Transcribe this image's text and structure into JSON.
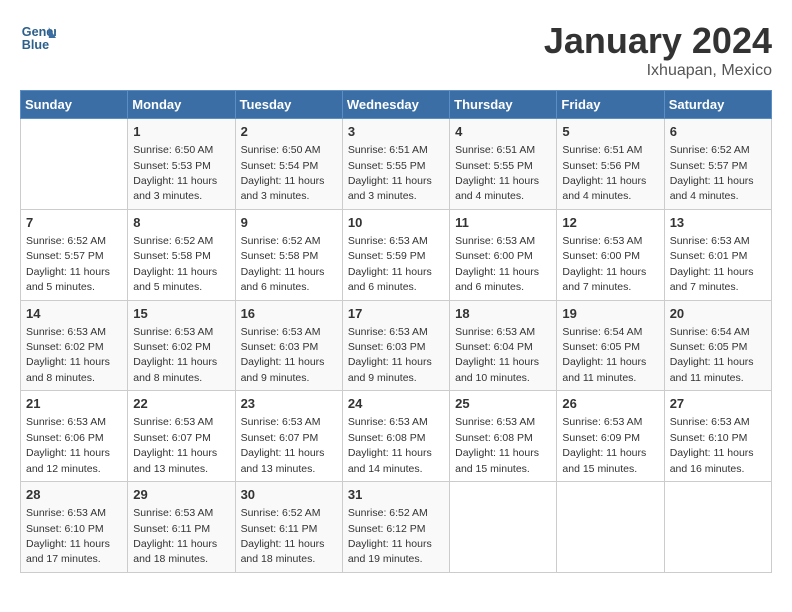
{
  "header": {
    "logo_line1": "General",
    "logo_line2": "Blue",
    "month": "January 2024",
    "location": "Ixhuapan, Mexico"
  },
  "weekdays": [
    "Sunday",
    "Monday",
    "Tuesday",
    "Wednesday",
    "Thursday",
    "Friday",
    "Saturday"
  ],
  "weeks": [
    [
      {
        "day": "",
        "info": ""
      },
      {
        "day": "1",
        "info": "Sunrise: 6:50 AM\nSunset: 5:53 PM\nDaylight: 11 hours\nand 3 minutes."
      },
      {
        "day": "2",
        "info": "Sunrise: 6:50 AM\nSunset: 5:54 PM\nDaylight: 11 hours\nand 3 minutes."
      },
      {
        "day": "3",
        "info": "Sunrise: 6:51 AM\nSunset: 5:55 PM\nDaylight: 11 hours\nand 3 minutes."
      },
      {
        "day": "4",
        "info": "Sunrise: 6:51 AM\nSunset: 5:55 PM\nDaylight: 11 hours\nand 4 minutes."
      },
      {
        "day": "5",
        "info": "Sunrise: 6:51 AM\nSunset: 5:56 PM\nDaylight: 11 hours\nand 4 minutes."
      },
      {
        "day": "6",
        "info": "Sunrise: 6:52 AM\nSunset: 5:57 PM\nDaylight: 11 hours\nand 4 minutes."
      }
    ],
    [
      {
        "day": "7",
        "info": "Sunrise: 6:52 AM\nSunset: 5:57 PM\nDaylight: 11 hours\nand 5 minutes."
      },
      {
        "day": "8",
        "info": "Sunrise: 6:52 AM\nSunset: 5:58 PM\nDaylight: 11 hours\nand 5 minutes."
      },
      {
        "day": "9",
        "info": "Sunrise: 6:52 AM\nSunset: 5:58 PM\nDaylight: 11 hours\nand 6 minutes."
      },
      {
        "day": "10",
        "info": "Sunrise: 6:53 AM\nSunset: 5:59 PM\nDaylight: 11 hours\nand 6 minutes."
      },
      {
        "day": "11",
        "info": "Sunrise: 6:53 AM\nSunset: 6:00 PM\nDaylight: 11 hours\nand 6 minutes."
      },
      {
        "day": "12",
        "info": "Sunrise: 6:53 AM\nSunset: 6:00 PM\nDaylight: 11 hours\nand 7 minutes."
      },
      {
        "day": "13",
        "info": "Sunrise: 6:53 AM\nSunset: 6:01 PM\nDaylight: 11 hours\nand 7 minutes."
      }
    ],
    [
      {
        "day": "14",
        "info": "Sunrise: 6:53 AM\nSunset: 6:02 PM\nDaylight: 11 hours\nand 8 minutes."
      },
      {
        "day": "15",
        "info": "Sunrise: 6:53 AM\nSunset: 6:02 PM\nDaylight: 11 hours\nand 8 minutes."
      },
      {
        "day": "16",
        "info": "Sunrise: 6:53 AM\nSunset: 6:03 PM\nDaylight: 11 hours\nand 9 minutes."
      },
      {
        "day": "17",
        "info": "Sunrise: 6:53 AM\nSunset: 6:03 PM\nDaylight: 11 hours\nand 9 minutes."
      },
      {
        "day": "18",
        "info": "Sunrise: 6:53 AM\nSunset: 6:04 PM\nDaylight: 11 hours\nand 10 minutes."
      },
      {
        "day": "19",
        "info": "Sunrise: 6:54 AM\nSunset: 6:05 PM\nDaylight: 11 hours\nand 11 minutes."
      },
      {
        "day": "20",
        "info": "Sunrise: 6:54 AM\nSunset: 6:05 PM\nDaylight: 11 hours\nand 11 minutes."
      }
    ],
    [
      {
        "day": "21",
        "info": "Sunrise: 6:53 AM\nSunset: 6:06 PM\nDaylight: 11 hours\nand 12 minutes."
      },
      {
        "day": "22",
        "info": "Sunrise: 6:53 AM\nSunset: 6:07 PM\nDaylight: 11 hours\nand 13 minutes."
      },
      {
        "day": "23",
        "info": "Sunrise: 6:53 AM\nSunset: 6:07 PM\nDaylight: 11 hours\nand 13 minutes."
      },
      {
        "day": "24",
        "info": "Sunrise: 6:53 AM\nSunset: 6:08 PM\nDaylight: 11 hours\nand 14 minutes."
      },
      {
        "day": "25",
        "info": "Sunrise: 6:53 AM\nSunset: 6:08 PM\nDaylight: 11 hours\nand 15 minutes."
      },
      {
        "day": "26",
        "info": "Sunrise: 6:53 AM\nSunset: 6:09 PM\nDaylight: 11 hours\nand 15 minutes."
      },
      {
        "day": "27",
        "info": "Sunrise: 6:53 AM\nSunset: 6:10 PM\nDaylight: 11 hours\nand 16 minutes."
      }
    ],
    [
      {
        "day": "28",
        "info": "Sunrise: 6:53 AM\nSunset: 6:10 PM\nDaylight: 11 hours\nand 17 minutes."
      },
      {
        "day": "29",
        "info": "Sunrise: 6:53 AM\nSunset: 6:11 PM\nDaylight: 11 hours\nand 18 minutes."
      },
      {
        "day": "30",
        "info": "Sunrise: 6:52 AM\nSunset: 6:11 PM\nDaylight: 11 hours\nand 18 minutes."
      },
      {
        "day": "31",
        "info": "Sunrise: 6:52 AM\nSunset: 6:12 PM\nDaylight: 11 hours\nand 19 minutes."
      },
      {
        "day": "",
        "info": ""
      },
      {
        "day": "",
        "info": ""
      },
      {
        "day": "",
        "info": ""
      }
    ]
  ]
}
